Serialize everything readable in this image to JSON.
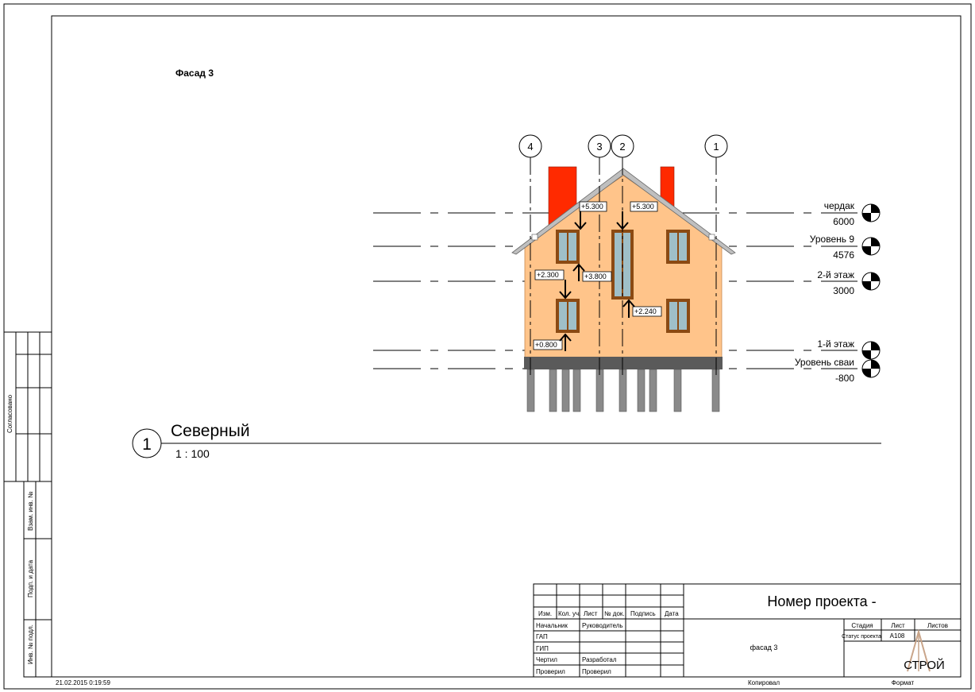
{
  "sheet": {
    "view_title": "Фасад 3",
    "date_stamp": "21.02.2015 0:19:59"
  },
  "side_stamps": {
    "agreed": "Согласовано",
    "replaced_inv": "Взам. инв. №",
    "sign_date": "Подп. и дата",
    "orig_inv": "Инв. № подл."
  },
  "elevation": {
    "label_number": "1",
    "label_name": "Северный",
    "scale": "1 : 100",
    "grid_axes": [
      "4",
      "3",
      "2",
      "1"
    ],
    "levels": [
      {
        "name": "чердак",
        "value": "6000"
      },
      {
        "name": "Уровень 9",
        "value": "4576"
      },
      {
        "name": "2-й этаж",
        "value": "3000"
      },
      {
        "name": "1-й этаж",
        "value": ""
      },
      {
        "name": "Уровень сваи",
        "value": "-800"
      }
    ],
    "spot_marks": [
      "+5.300",
      "+5.300",
      "+2.300",
      "+3.800",
      "+2.240",
      "+0.800"
    ],
    "colors": {
      "wall": "#ffc48a",
      "chimney": "#ff2a00",
      "roof": "#bfbfbf",
      "plinth": "#5a5a5a",
      "pile": "#8a8a8a",
      "frame": "#8b4a13",
      "glass": "#9fbfc8"
    }
  },
  "title_block": {
    "project_number": "Номер проекта -",
    "sheet_name": "фасад 3",
    "headers": [
      "Изм.",
      "Кол. уч.",
      "Лист",
      "№ док.",
      "Подпись",
      "Дата"
    ],
    "roles_left": [
      "Начальник",
      "ГАП",
      "ГИП",
      "Чертил",
      "Проверил"
    ],
    "roles_right": [
      "Руководитель",
      "",
      "",
      "Разработал",
      "Проверил"
    ],
    "stage_header": "Стадия",
    "sheet_header": "Лист",
    "sheets_header": "Листов",
    "status_label": "Статус проекта",
    "sheet_value": "A108",
    "copied": "Копировал",
    "format": "Формат",
    "logo_text": "СТРОЙ"
  }
}
